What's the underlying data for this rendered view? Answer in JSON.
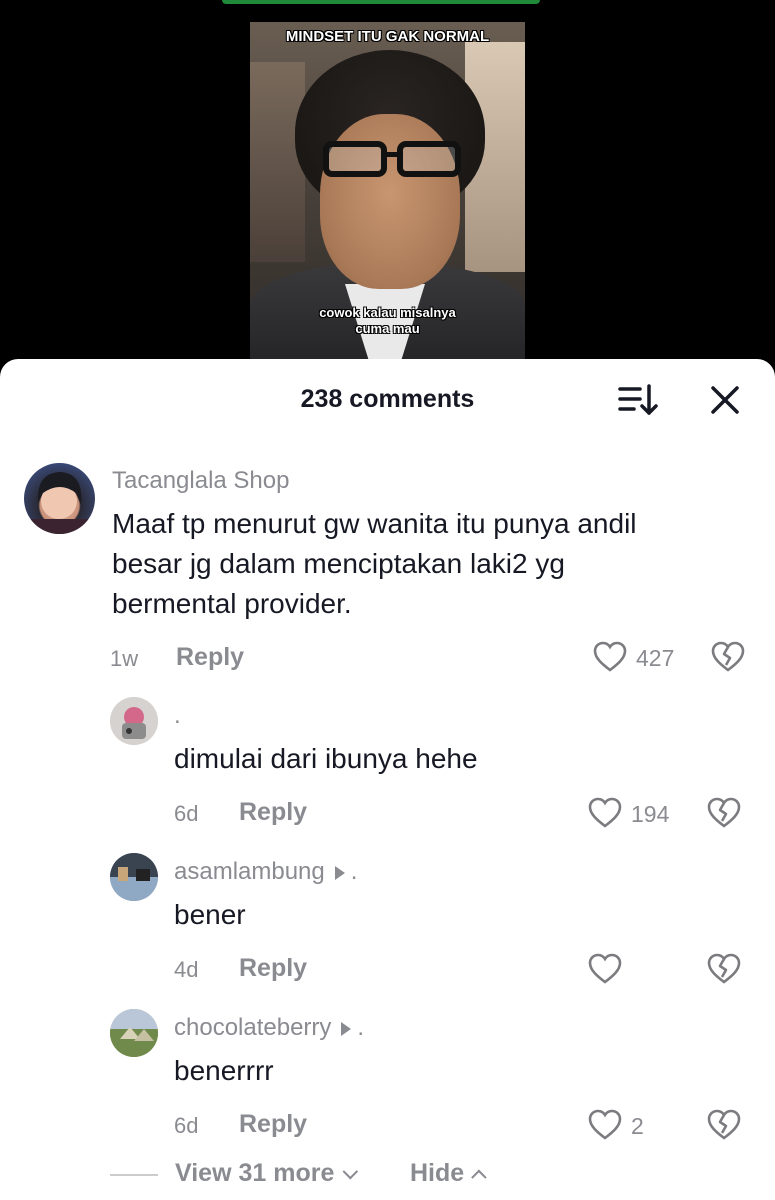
{
  "video": {
    "top_caption": "MINDSET ITU GAK NORMAL",
    "bottom_caption_line1": "cowok kalau misalnya",
    "bottom_caption_line2": "cuma mau"
  },
  "sheet": {
    "title": "238 comments",
    "sort_icon": "sort-descending-icon",
    "close_icon": "close-icon"
  },
  "comments": [
    {
      "username": "Tacanglala Shop",
      "text_lines": [
        "Maaf tp menurut gw wanita itu punya andil",
        "besar jg dalam menciptakan laki2 yg",
        "bermental provider."
      ],
      "time": "1w",
      "reply_label": "Reply",
      "likes": "427"
    }
  ],
  "replies": [
    {
      "username": ".",
      "text": "dimulai dari ibunya hehe",
      "time": "6d",
      "reply_label": "Reply",
      "likes": "194"
    },
    {
      "username": "asamlambung",
      "text": "bener",
      "time": "4d",
      "reply_label": "Reply",
      "likes": ""
    },
    {
      "username": "chocolateberry",
      "text": "benerrrr",
      "time": "6d",
      "reply_label": "Reply",
      "likes": "2"
    }
  ],
  "thread_footer": {
    "view_more": "View 31 more",
    "hide": "Hide"
  },
  "colors": {
    "sheet_bg": "#ffffff",
    "text_primary": "#161823",
    "text_secondary": "#8a8b91"
  }
}
